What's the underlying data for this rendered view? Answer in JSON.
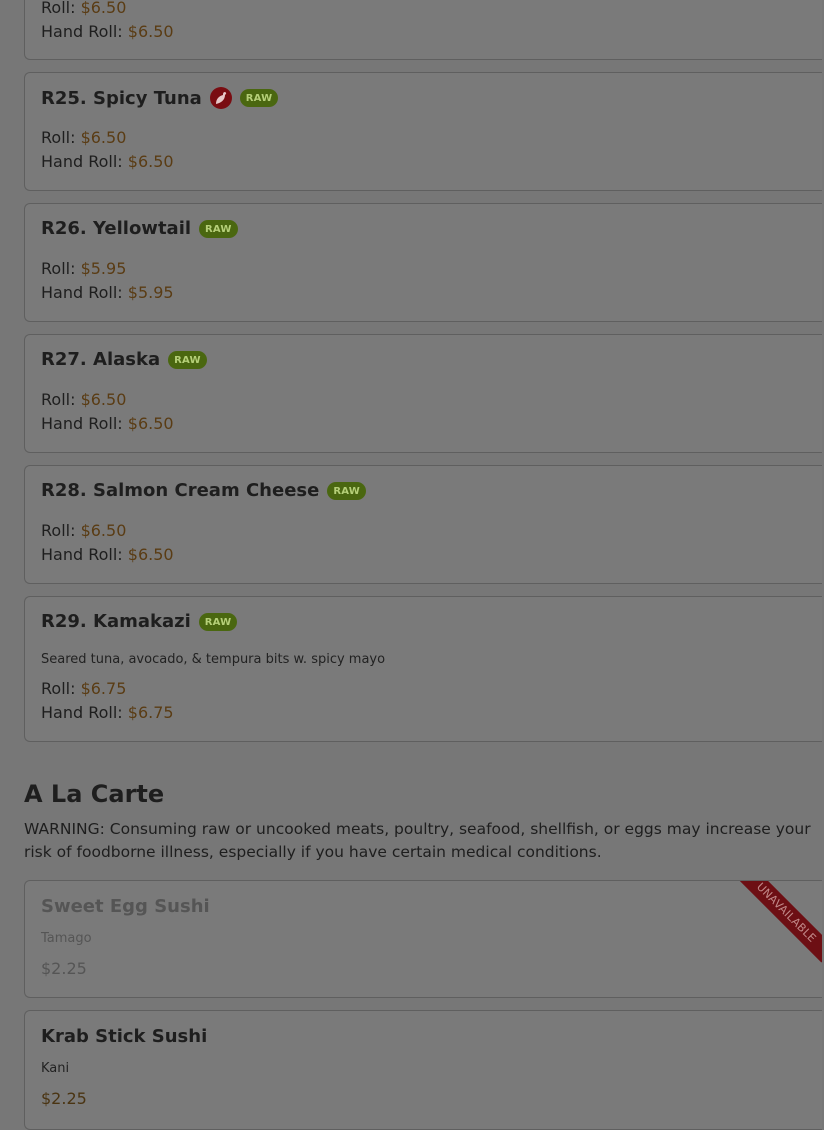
{
  "items": [
    {
      "id": "r24",
      "title": "",
      "badges": [],
      "spicy": false,
      "description": "",
      "prices": [
        {
          "label": "Roll:",
          "amount": "$6.50"
        },
        {
          "label": "Hand Roll:",
          "amount": "$6.50"
        }
      ]
    },
    {
      "id": "r25",
      "title": "R25. Spicy Tuna",
      "badges": [
        "RAW"
      ],
      "spicy": true,
      "description": "",
      "prices": [
        {
          "label": "Roll:",
          "amount": "$6.50"
        },
        {
          "label": "Hand Roll:",
          "amount": "$6.50"
        }
      ]
    },
    {
      "id": "r26",
      "title": "R26. Yellowtail",
      "badges": [
        "RAW"
      ],
      "spicy": false,
      "description": "",
      "prices": [
        {
          "label": "Roll:",
          "amount": "$5.95"
        },
        {
          "label": "Hand Roll:",
          "amount": "$5.95"
        }
      ]
    },
    {
      "id": "r27",
      "title": "R27. Alaska",
      "badges": [
        "RAW"
      ],
      "spicy": false,
      "description": "",
      "prices": [
        {
          "label": "Roll:",
          "amount": "$6.50"
        },
        {
          "label": "Hand Roll:",
          "amount": "$6.50"
        }
      ]
    },
    {
      "id": "r28",
      "title": "R28. Salmon Cream Cheese",
      "badges": [
        "RAW"
      ],
      "spicy": false,
      "description": "",
      "prices": [
        {
          "label": "Roll:",
          "amount": "$6.50"
        },
        {
          "label": "Hand Roll:",
          "amount": "$6.50"
        }
      ]
    },
    {
      "id": "r29",
      "title": "R29. Kamakazi",
      "badges": [
        "RAW"
      ],
      "spicy": false,
      "description": "Seared tuna, avocado, & tempura bits w. spicy mayo",
      "prices": [
        {
          "label": "Roll:",
          "amount": "$6.75"
        },
        {
          "label": "Hand Roll:",
          "amount": "$6.75"
        }
      ]
    }
  ],
  "section": {
    "title": "A La Carte",
    "warning": "WARNING: Consuming raw or uncooked meats, poultry, seafood, shellfish, or eggs may increase your risk of foodborne illness, especially if you have certain medical conditions."
  },
  "carte_items": [
    {
      "id": "egg",
      "title": "Sweet Egg Sushi",
      "description": "Tamago",
      "price": "$2.25",
      "unavailable": true,
      "ribbon": "UNAVAILABLE"
    },
    {
      "id": "krab",
      "title": "Krab Stick Sushi",
      "description": "Kani",
      "price": "$2.25",
      "unavailable": false
    }
  ],
  "colors": {
    "overlay_bg": "#777777",
    "raw_badge": "#4a6710",
    "ribbon": "#6d0f14",
    "price": "#5a3c14"
  },
  "icons": {
    "spicy": "chili-pepper-icon"
  }
}
